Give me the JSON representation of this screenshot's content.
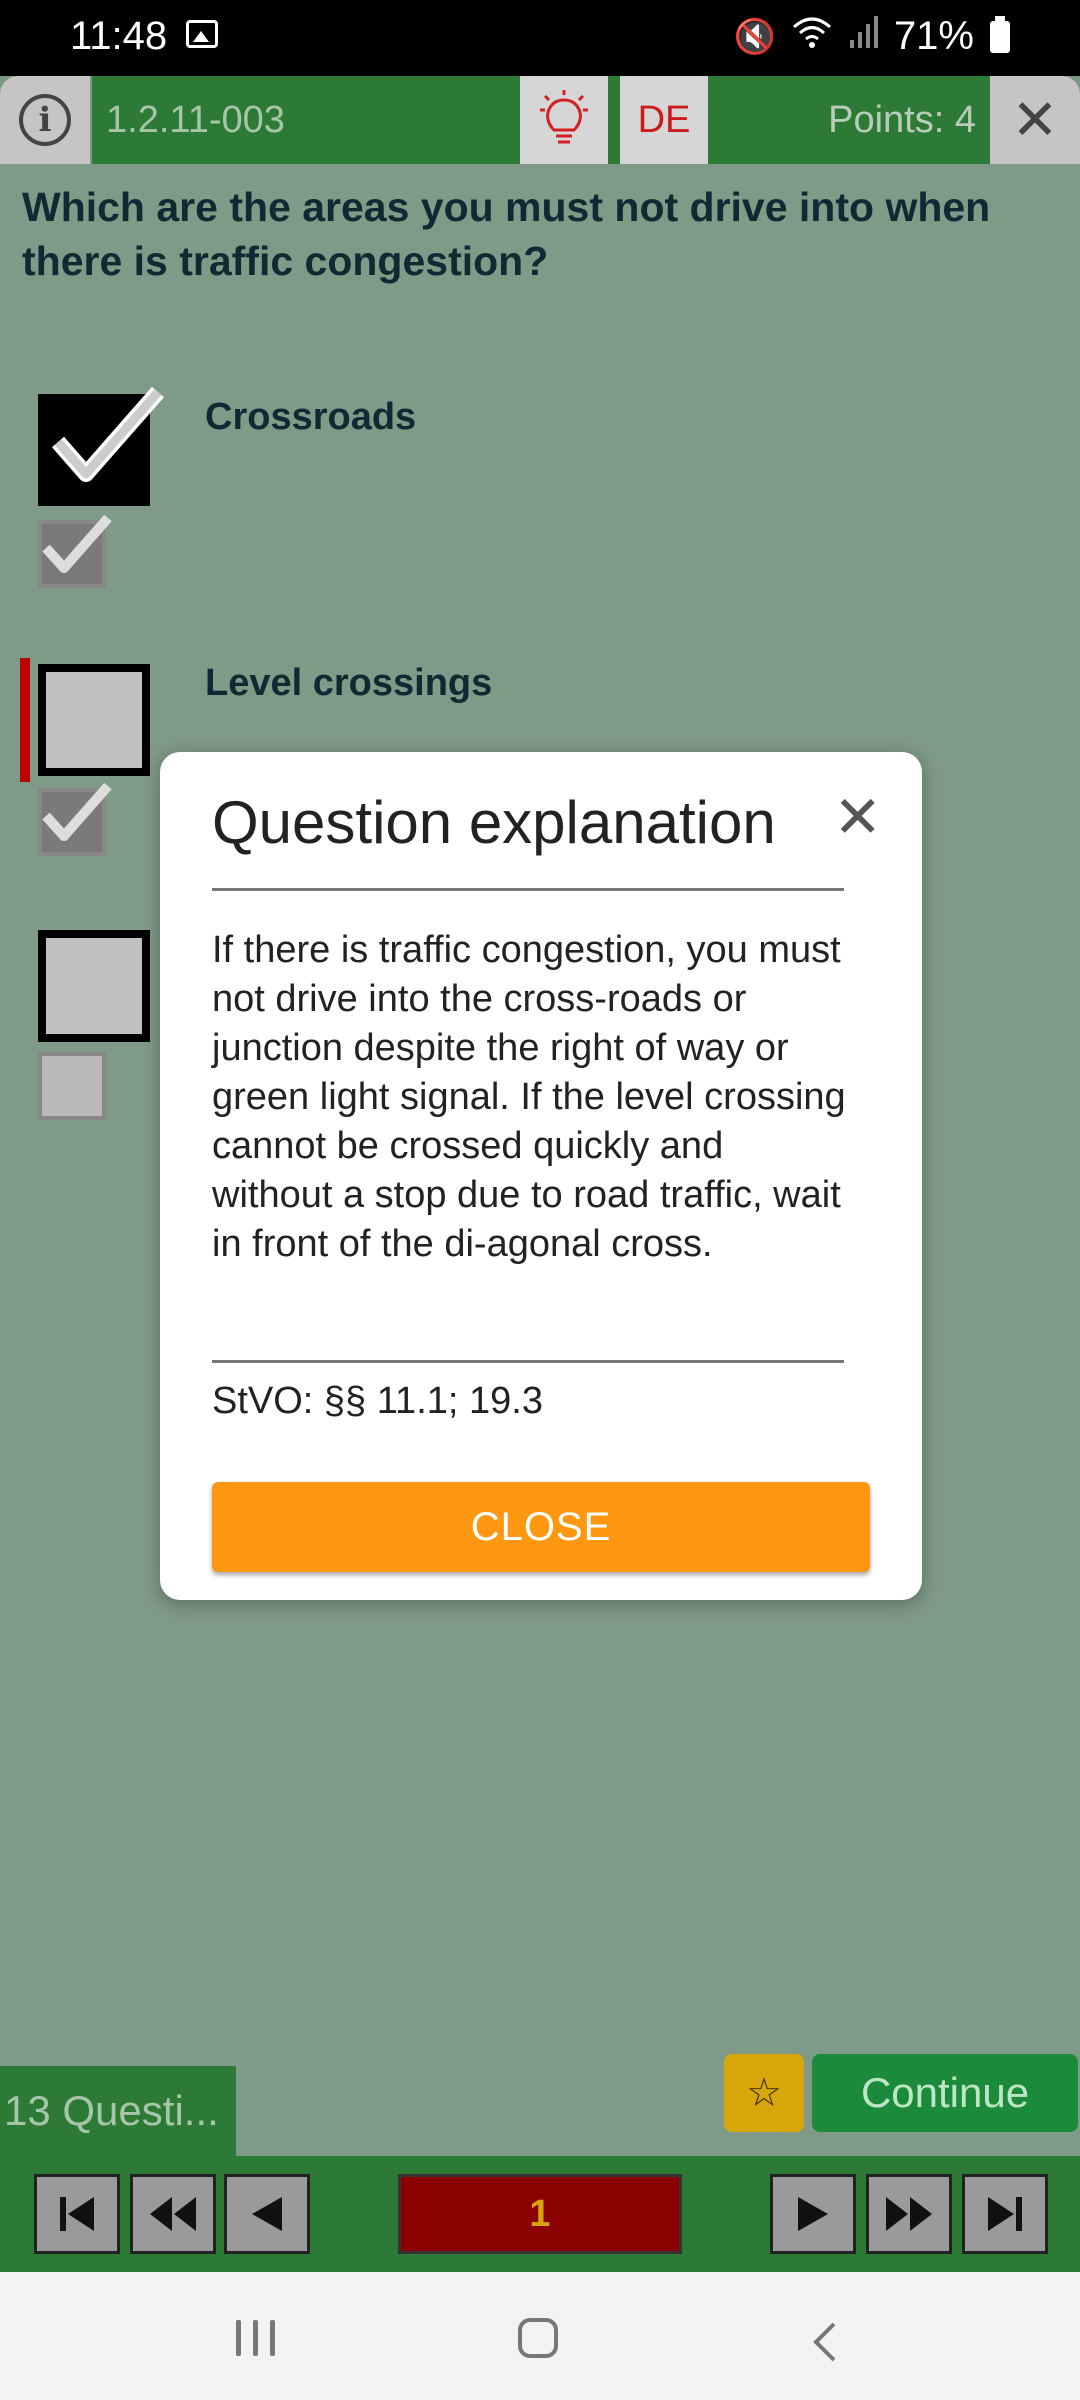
{
  "status_bar": {
    "time": "11:48",
    "battery": "71%"
  },
  "header": {
    "question_id": "1.2.11-003",
    "language": "DE",
    "points": "Points: 4"
  },
  "question": {
    "text": "Which are the areas you must not drive into when there is traffic congestion?"
  },
  "answers": [
    {
      "label": "Crossroads",
      "checked": true,
      "solution_checked": true
    },
    {
      "label": "Level crossings",
      "checked": false,
      "solution_checked": true
    },
    {
      "label": "",
      "checked": false,
      "solution_checked": false
    }
  ],
  "dialog": {
    "title": "Question explanation",
    "body": "If there is traffic congestion, you must not drive into the cross-roads or junction despite the right of way or green light signal. If the level crossing cannot be crossed quickly and without a stop due to road traffic, wait in front of the di-agonal cross.",
    "reference": "StVO: §§ 11.1; 19.3",
    "close_label": "CLOSE"
  },
  "footer": {
    "question_count": "13 Questi...",
    "continue_label": "Continue",
    "current_page": "1"
  },
  "colors": {
    "accent": "#ff9810",
    "header_green": "#2d7a36",
    "background": "#7f9a87"
  }
}
